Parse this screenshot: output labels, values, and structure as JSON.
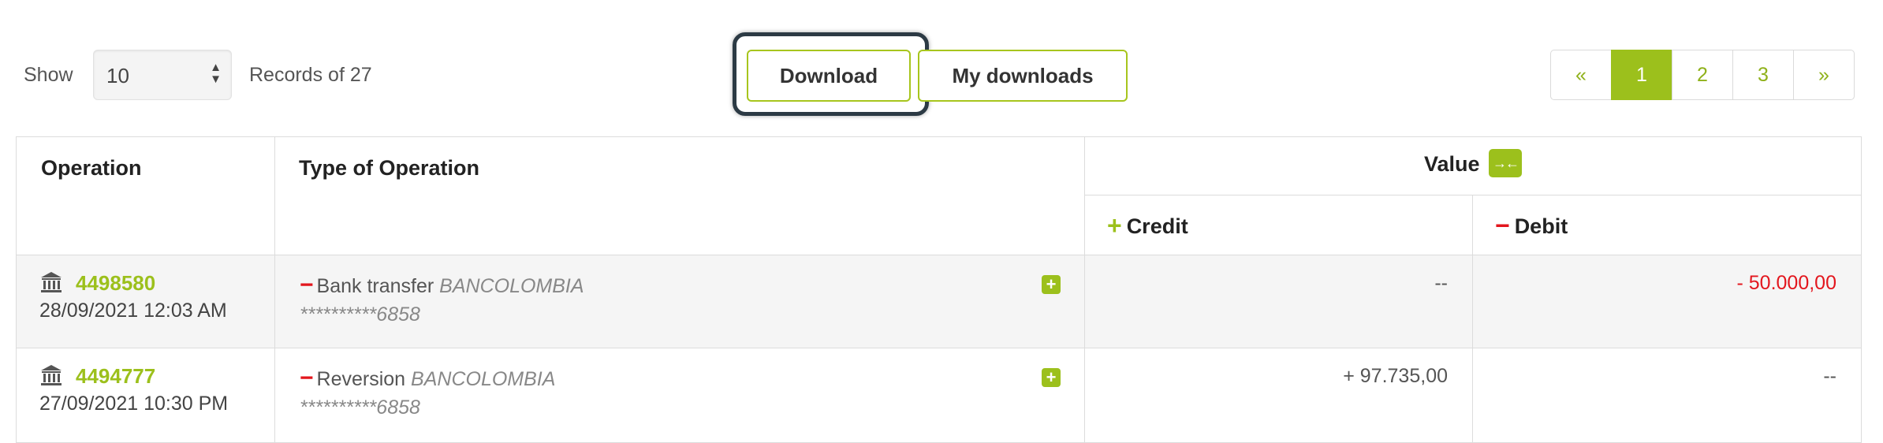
{
  "toolbar": {
    "show_label": "Show",
    "page_size": "10",
    "records_text": "Records of 27",
    "download_label": "Download",
    "my_downloads_label": "My downloads"
  },
  "pagination": {
    "first": "«",
    "pages": [
      "1",
      "2",
      "3"
    ],
    "active_page": "1",
    "last": "»"
  },
  "table": {
    "headers": {
      "operation": "Operation",
      "type": "Type of Operation",
      "value": "Value",
      "credit": "Credit",
      "debit": "Debit"
    },
    "rows": [
      {
        "op_number": "4498580",
        "date": "28/09/2021 12:03 AM",
        "type": "Bank transfer",
        "bank": "BANCOLOMBIA",
        "account": "**********6858",
        "credit": "--",
        "debit": "- 50.000,00"
      },
      {
        "op_number": "4494777",
        "date": "27/09/2021 10:30 PM",
        "type": "Reversion",
        "bank": "BANCOLOMBIA",
        "account": "**********6858",
        "credit": "+ 97.735,00",
        "debit": "--"
      }
    ]
  },
  "icons": {
    "bank": "bank-icon",
    "expand": "plus-square-icon",
    "collapse": "collapse-arrows-icon"
  },
  "colors": {
    "accent": "#9cc01c",
    "negative": "#e3161d",
    "focus_ring": "#2c3a44"
  }
}
